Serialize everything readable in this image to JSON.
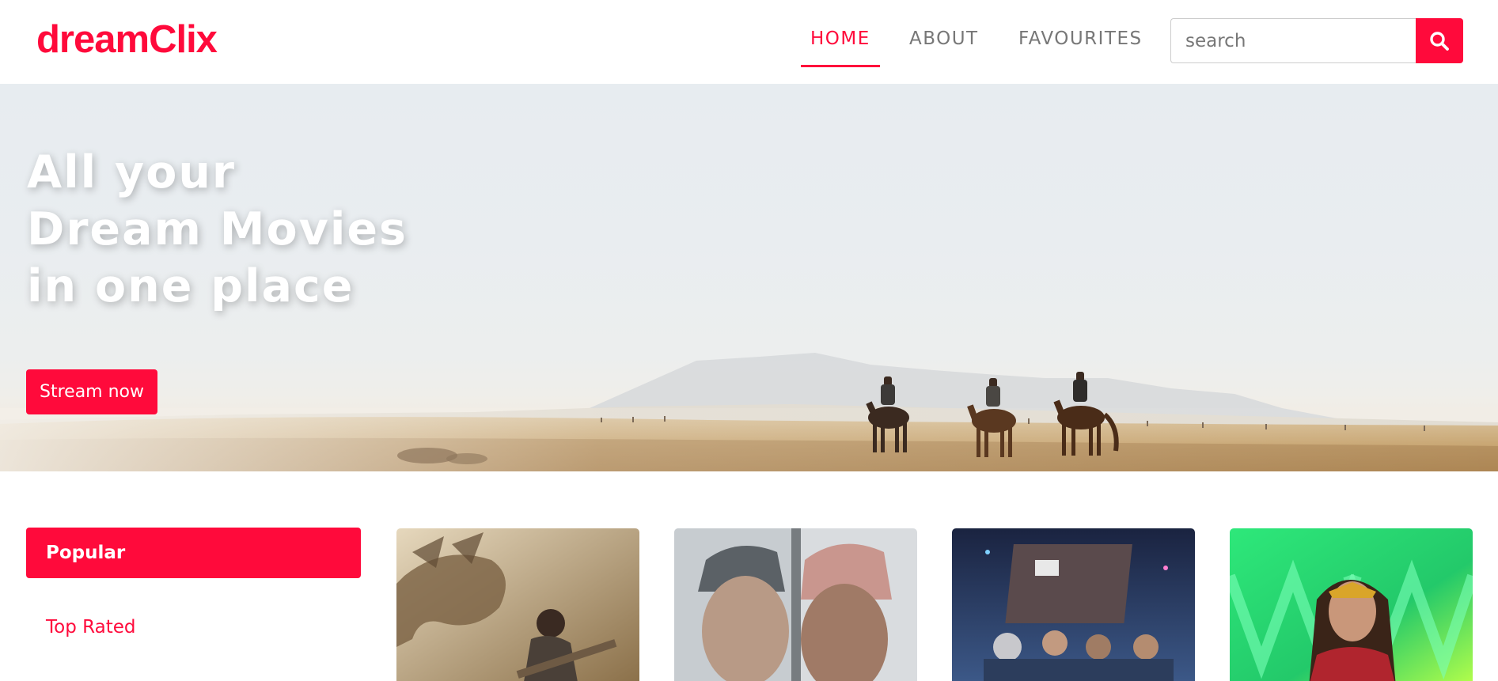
{
  "brand": {
    "logo_text": "dreamClix",
    "accent_color": "#ff0a3b"
  },
  "nav": {
    "links": [
      {
        "label": "HOME",
        "active": true
      },
      {
        "label": "ABOUT",
        "active": false
      },
      {
        "label": "FAVOURITES",
        "active": false
      }
    ]
  },
  "search": {
    "placeholder": "search",
    "value": "",
    "button_icon": "search-icon"
  },
  "hero": {
    "title_lines": [
      "All your",
      "Dream Movies",
      "in one place"
    ],
    "cta_label": "Stream now",
    "background": "foggy-prairie-horse-riders"
  },
  "categories": [
    {
      "label": "Popular",
      "active": true
    },
    {
      "label": "Top Rated",
      "active": false
    }
  ],
  "movies": [
    {
      "poster": "monster-hunter"
    },
    {
      "poster": "frozen-faces-split"
    },
    {
      "poster": "space-sweepers"
    },
    {
      "poster": "wonder-woman-1984"
    }
  ]
}
